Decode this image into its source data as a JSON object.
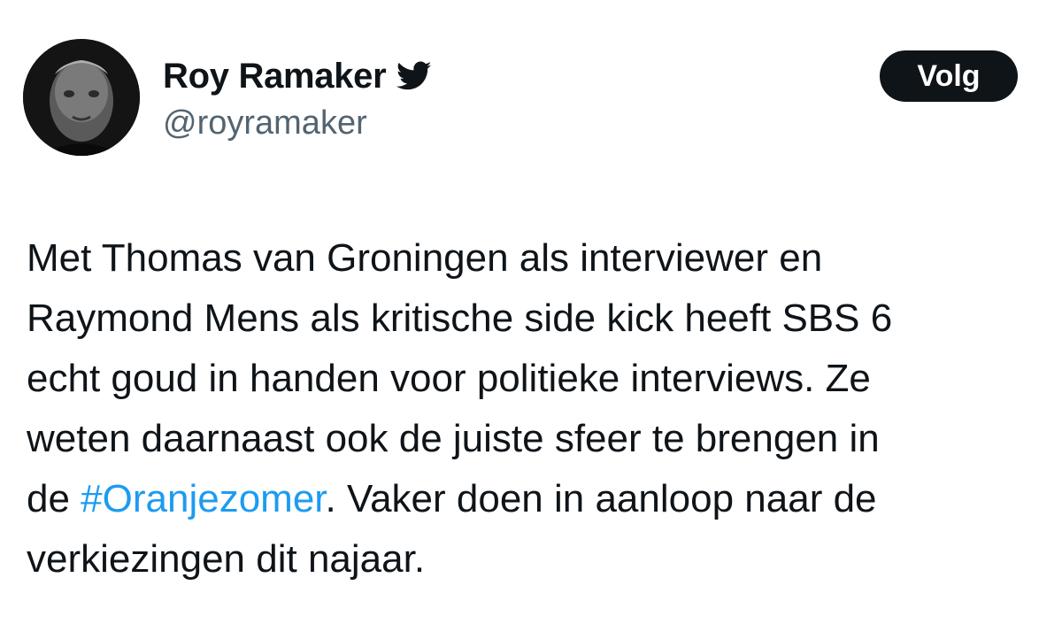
{
  "author": {
    "display_name": "Roy Ramaker",
    "handle": "@royramaker",
    "verified_icon": "twitter-bird-icon"
  },
  "follow_button": {
    "label": "Volg",
    "background": "#0f1419",
    "color": "#ffffff"
  },
  "tweet": {
    "lines": [
      "Met Thomas van Groningen als interviewer en",
      "Raymond Mens als kritische side kick heeft SBS 6",
      "echt goud in handen voor politieke interviews. Ze",
      "weten daarnaast ook de juiste sfeer te brengen in"
    ],
    "line5_prefix": "de ",
    "hashtag": "#Oranjezomer",
    "line5_suffix": ". Vaker doen in aanloop naar de",
    "line6": "verkiezingen dit najaar."
  },
  "colors": {
    "text": "#0f1419",
    "secondary": "#536471",
    "link": "#1d9bf0"
  }
}
